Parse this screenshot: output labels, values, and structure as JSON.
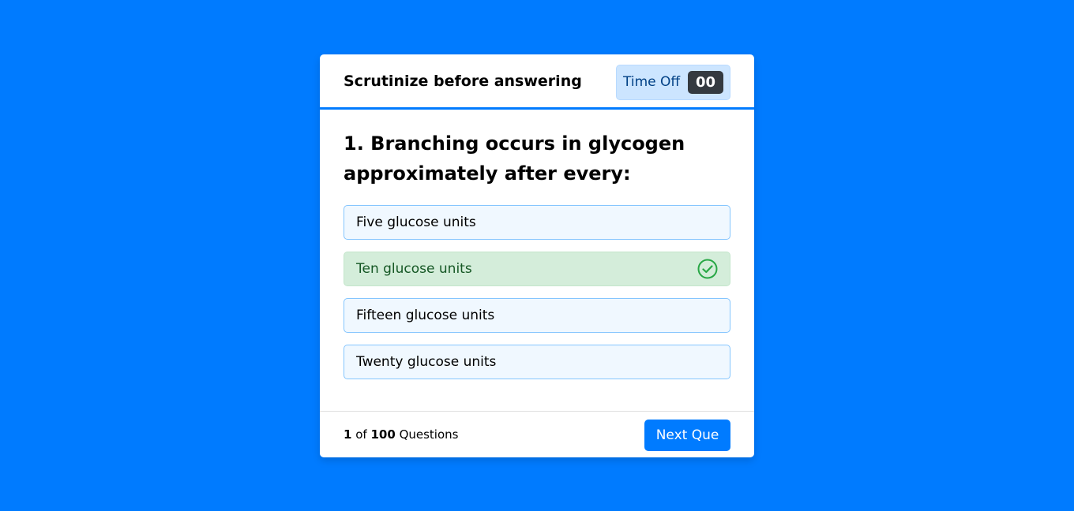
{
  "header": {
    "title": "Scrutinize before answering",
    "timer_label": "Time Off",
    "timer_seconds": "00"
  },
  "question": {
    "text": "1. Branching occurs in glycogen approximately after every:",
    "options": [
      {
        "label": "Five glucose units",
        "state": "default"
      },
      {
        "label": "Ten glucose units",
        "state": "correct"
      },
      {
        "label": "Fifteen glucose units",
        "state": "default"
      },
      {
        "label": "Twenty glucose units",
        "state": "default"
      }
    ]
  },
  "footer": {
    "current": "1",
    "of_label": "of",
    "total": "100",
    "questions_label": "Questions",
    "next_label": "Next Que"
  },
  "colors": {
    "background": "#007bff",
    "correct_bg": "#d4edda",
    "correct_icon": "#28a745",
    "option_bg": "#f0f8ff",
    "timer_bg": "#cce5ff"
  },
  "icons": {
    "correct": "check-circle-icon"
  }
}
